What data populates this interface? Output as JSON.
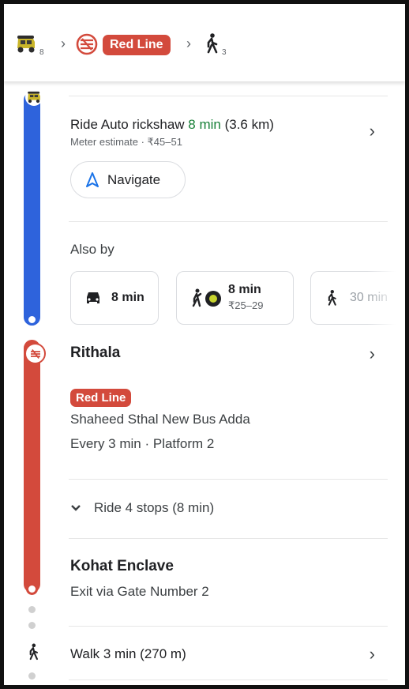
{
  "summary": {
    "auto_count": "8",
    "line_label": "Red Line",
    "walk_count": "3",
    "separator": "›"
  },
  "auto_leg": {
    "ride_prefix": "Ride Auto rickshaw ",
    "ride_time": "8 min",
    "ride_distance": " (3.6 km)",
    "estimate": "Meter estimate · ₹45–51",
    "navigate_label": "Navigate",
    "also_by_label": "Also by",
    "options": [
      {
        "icon": "car-icon",
        "time": "8 min",
        "price": ""
      },
      {
        "icon": "ride-hail-icon",
        "time": "8 min",
        "price": "₹25–29"
      },
      {
        "icon": "walk-icon",
        "time": "30 min",
        "price": ""
      }
    ]
  },
  "metro_leg": {
    "station": "Rithala",
    "line_label": "Red Line",
    "direction": "Shaheed Sthal New Bus Adda",
    "frequency": "Every 3 min · Platform 2",
    "ride_stops": "Ride 4 stops (8 min)",
    "end_station": "Kohat Enclave",
    "exit": "Exit via Gate Number 2"
  },
  "walk_leg": {
    "label": "Walk 3 min (270 m)"
  },
  "colors": {
    "blue_line": "#2e63dc",
    "red_line": "#d34a3c",
    "green_time": "#188038"
  }
}
